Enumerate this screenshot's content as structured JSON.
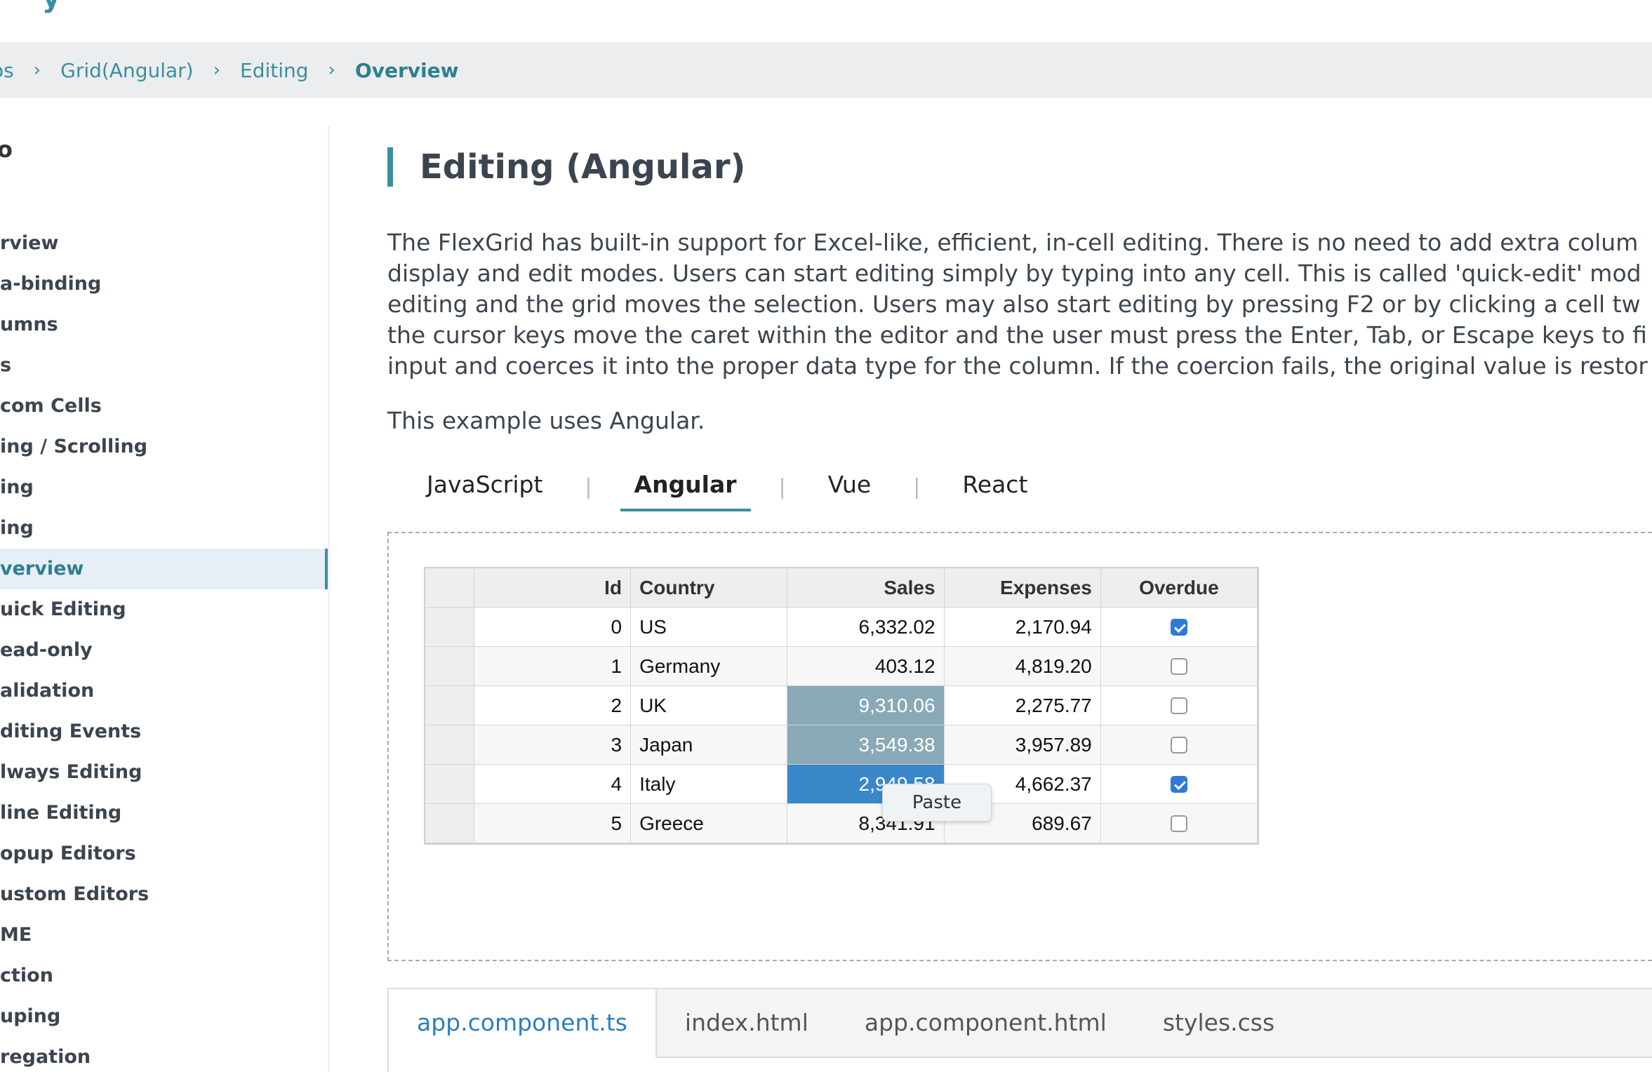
{
  "brand": {
    "tail": "y"
  },
  "breadcrumb": {
    "items": [
      "os",
      "Grid(Angular)",
      "Editing",
      "Overview"
    ],
    "separator": "›"
  },
  "sidebar": {
    "section_title": "o",
    "items": [
      {
        "label": "rview",
        "active": false
      },
      {
        "label": "a-binding",
        "active": false
      },
      {
        "label": "umns",
        "active": false
      },
      {
        "label": "s",
        "active": false
      },
      {
        "label": "com Cells",
        "active": false
      },
      {
        "label": "ing / Scrolling",
        "active": false
      },
      {
        "label": "ing",
        "active": false
      },
      {
        "label": "ing",
        "active": false
      },
      {
        "label": "verview",
        "active": true
      },
      {
        "label": "uick Editing",
        "active": false
      },
      {
        "label": "ead-only",
        "active": false
      },
      {
        "label": "alidation",
        "active": false
      },
      {
        "label": "diting Events",
        "active": false
      },
      {
        "label": "lways Editing",
        "active": false
      },
      {
        "label": "line Editing",
        "active": false
      },
      {
        "label": "opup Editors",
        "active": false
      },
      {
        "label": "ustom Editors",
        "active": false
      },
      {
        "label": "ME",
        "active": false
      },
      {
        "label": "ction",
        "active": false
      },
      {
        "label": "uping",
        "active": false
      },
      {
        "label": "regation",
        "active": false
      }
    ]
  },
  "main": {
    "title": "Editing (Angular)",
    "intro_lines": [
      "The FlexGrid has built-in support for Excel-like, efficient, in-cell editing. There is no need to add extra colum",
      "display and edit modes. Users can start editing simply by typing into any cell. This is called 'quick-edit' mod",
      "editing and the grid moves the selection. Users may also start editing by pressing F2 or by clicking a cell tw",
      "the cursor keys move the caret within the editor and the user must press the Enter, Tab, or Escape keys to fi",
      "input and coerces it into the proper data type for the column. If the coercion fails, the original value is restor"
    ],
    "uses_text": "This example uses Angular.",
    "framework_tabs": [
      {
        "label": "JavaScript",
        "active": false
      },
      {
        "label": "Angular",
        "active": true
      },
      {
        "label": "Vue",
        "active": false
      },
      {
        "label": "React",
        "active": false
      }
    ]
  },
  "grid": {
    "columns": [
      "",
      "Id",
      "Country",
      "Sales",
      "Expenses",
      "Overdue"
    ],
    "rows": [
      {
        "id": "0",
        "country": "US",
        "sales": "6,332.02",
        "expenses": "2,170.94",
        "overdue": true
      },
      {
        "id": "1",
        "country": "Germany",
        "sales": "403.12",
        "expenses": "4,819.20",
        "overdue": false
      },
      {
        "id": "2",
        "country": "UK",
        "sales": "9,310.06",
        "expenses": "2,275.77",
        "overdue": false
      },
      {
        "id": "3",
        "country": "Japan",
        "sales": "3,549.38",
        "expenses": "3,957.89",
        "overdue": false
      },
      {
        "id": "4",
        "country": "Italy",
        "sales": "2,949.58",
        "expenses": "4,662.37",
        "overdue": true
      },
      {
        "id": "5",
        "country": "Greece",
        "sales": "8,341.91",
        "expenses": "689.67",
        "overdue": false
      }
    ],
    "selected_sales_rows": [
      2,
      3
    ],
    "cursor_sales_row": 4
  },
  "context_menu": {
    "paste_label": "Paste"
  },
  "code_tabs": [
    {
      "label": "app.component.ts",
      "active": true
    },
    {
      "label": "index.html",
      "active": false
    },
    {
      "label": "app.component.html",
      "active": false
    },
    {
      "label": "styles.css",
      "active": false
    }
  ],
  "colors": {
    "accent": "#3a8fa0",
    "selection": "#8aa9b6",
    "cursor": "#3a87c9",
    "link": "#2e7dbf"
  }
}
